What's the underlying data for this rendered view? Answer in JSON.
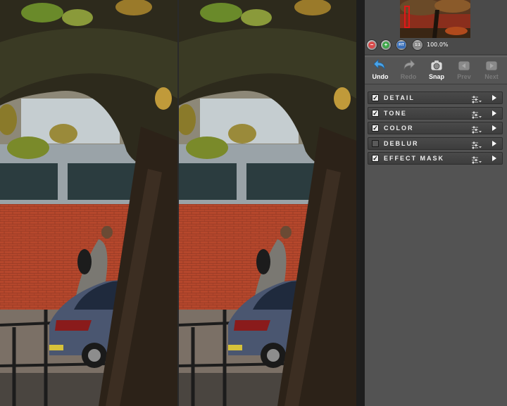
{
  "navigator": {
    "zoom_level": "100.0%",
    "zoom_out_glyph": "−",
    "zoom_in_glyph": "+",
    "zoom_fit_glyph": "FIT",
    "zoom_actual_glyph": "1:1"
  },
  "toolbar": {
    "undo_label": "Undo",
    "redo_label": "Redo",
    "snap_label": "Snap",
    "prev_label": "Prev",
    "next_label": "Next"
  },
  "sections": [
    {
      "label": "DETAIL",
      "checked": true
    },
    {
      "label": "TONE",
      "checked": true
    },
    {
      "label": "COLOR",
      "checked": true
    },
    {
      "label": "DEBLUR",
      "checked": false
    },
    {
      "label": "EFFECT MASK",
      "checked": true
    }
  ],
  "colors": {
    "brick": "#b5472c",
    "car": "#4a5670",
    "trunk": "#2c2218",
    "panel_bg": "#535353",
    "accent_undo": "#4aa3e8"
  },
  "icons": {
    "undo": "undo-arrow-icon",
    "redo": "redo-arrow-icon",
    "snap": "camera-icon",
    "prev": "prev-icon",
    "next": "next-icon"
  }
}
